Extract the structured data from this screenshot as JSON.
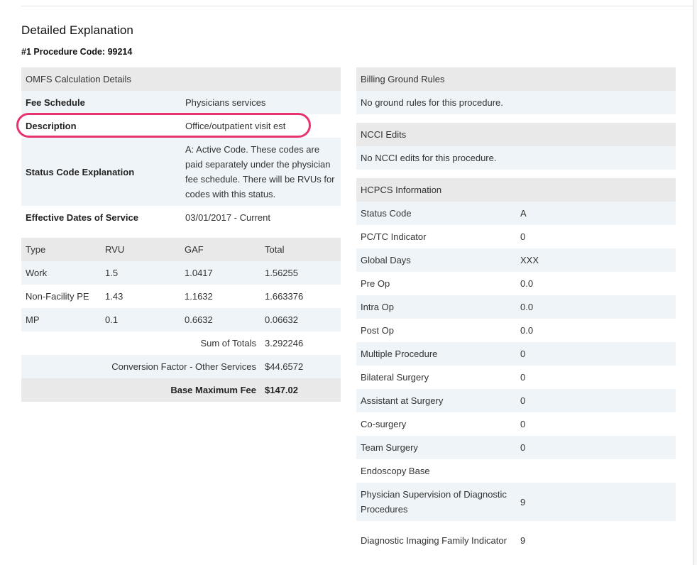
{
  "title": "Detailed Explanation",
  "procedure_heading": "#1 Procedure Code: 99214",
  "omfs": {
    "header": "OMFS Calculation Details",
    "rows": [
      {
        "label": "Fee Schedule",
        "value": "Physicians services"
      },
      {
        "label": "Description",
        "value": "Office/outpatient visit est"
      },
      {
        "label": "Status Code Explanation",
        "value": "A: Active Code. These codes are paid separately under the physician fee schedule. There will be RVUs for codes with this status."
      },
      {
        "label": "Effective Dates of Service",
        "value": "03/01/2017 - Current"
      }
    ]
  },
  "rvu_table": {
    "columns": [
      "Type",
      "RVU",
      "GAF",
      "Total"
    ],
    "rows": [
      [
        "Work",
        "1.5",
        "1.0417",
        "1.56255"
      ],
      [
        "Non-Facility PE",
        "1.43",
        "1.1632",
        "1.663376"
      ],
      [
        "MP",
        "0.1",
        "0.6632",
        "0.06632"
      ]
    ],
    "sum_label": "Sum of Totals",
    "sum_value": "3.292246",
    "cf_label": "Conversion Factor - Other Services",
    "cf_value": "$44.6572",
    "base_label": "Base Maximum Fee",
    "base_value": "$147.02"
  },
  "billing": {
    "header": "Billing Ground Rules",
    "text": "No ground rules for this procedure."
  },
  "ncci": {
    "header": "NCCI Edits",
    "text": "No NCCI edits for this procedure."
  },
  "hcpcs": {
    "header": "HCPCS Information",
    "rows": [
      {
        "label": "Status Code",
        "value": "A"
      },
      {
        "label": "PC/TC Indicator",
        "value": "0"
      },
      {
        "label": "Global Days",
        "value": "XXX"
      },
      {
        "label": "Pre Op",
        "value": "0.0"
      },
      {
        "label": "Intra Op",
        "value": "0.0"
      },
      {
        "label": "Post Op",
        "value": "0.0"
      },
      {
        "label": "Multiple Procedure",
        "value": "0"
      },
      {
        "label": "Bilateral Surgery",
        "value": "0"
      },
      {
        "label": "Assistant at Surgery",
        "value": "0"
      },
      {
        "label": "Co-surgery",
        "value": "0"
      },
      {
        "label": "Team Surgery",
        "value": "0"
      },
      {
        "label": "Endoscopy Base",
        "value": ""
      },
      {
        "label": "Physician Supervision of Diagnostic Procedures",
        "value": "9"
      },
      {
        "label": "Diagnostic Imaging Family Indicator",
        "value": "9"
      }
    ]
  },
  "colors": {
    "highlight": "#e8336e",
    "header_bg": "#e9e9e9",
    "alt_row_bg": "#eef4f7"
  }
}
